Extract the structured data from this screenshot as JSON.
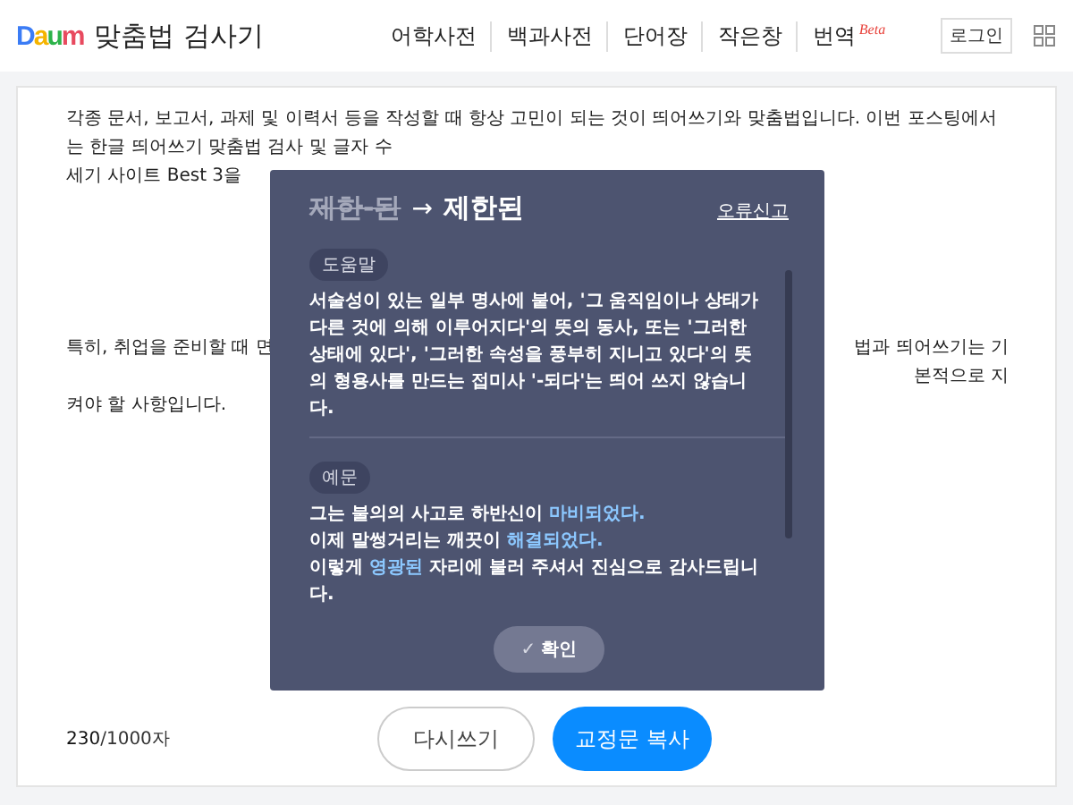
{
  "header": {
    "logo": "Daum",
    "title": "맞춤법 검사기",
    "nav": [
      {
        "label": "어학사전"
      },
      {
        "label": "백과사전"
      },
      {
        "label": "단어장"
      },
      {
        "label": "작은창"
      },
      {
        "label": "번역",
        "badge": "Beta"
      }
    ],
    "login": "로그인"
  },
  "editor": {
    "paragraphs": [
      {
        "lines": [
          {
            "left": "각종 문서, 보고서, 과제 및 이력서 등을 작성할 때 항상 고민이 되는 것이 띄어쓰기와 맞춤법입니다. 이번 포스팅에서는 한글 띄어쓰기 맞춤법 검사 및 글자 수"
          },
          {
            "left": "세기 사이트 Best 3을"
          }
        ]
      },
      {
        "lines": [
          {
            "left": "특히, 취업을 준비할 때 면",
            "right": "법과 띄어쓰기는 기본적으로 지"
          },
          {
            "left": "켜야 할 사항입니다."
          }
        ]
      }
    ],
    "count": "230",
    "limit": "/1000자",
    "buttons": [
      {
        "label": "다시쓰기",
        "kind": "secondary"
      },
      {
        "label": "교정문 복사",
        "kind": "primary"
      }
    ]
  },
  "popup": {
    "wrong": "제한-된",
    "arrow": "→",
    "correct": "제한된",
    "report": "오류신고",
    "sections": [
      {
        "tag": "도움말",
        "lines": [
          [
            {
              "text": "서술성이 있는 일부 명사에 붙어, '그 움직임이나 상태가 다른 것에 의해 이루어지다'의 뜻의 동사, 또는 '그러한 상태에 있다', '그러한 속성을 풍부히 지니고 있다'의 뜻의 형용사를 만드는 접미사 '-되다'는 띄어 쓰지 않습니다.",
              "highlighted": false
            }
          ]
        ]
      },
      {
        "tag": "예문",
        "lines": [
          [
            {
              "text": "그는 불의의 사고로 하반신이 ",
              "highlighted": false
            },
            {
              "text": "마비되었다.",
              "highlighted": true
            }
          ],
          [
            {
              "text": "이제 말썽거리는 깨끗이 ",
              "highlighted": false
            },
            {
              "text": "해결되었다.",
              "highlighted": true
            }
          ],
          [
            {
              "text": "이렇게 ",
              "highlighted": false
            },
            {
              "text": "영광된",
              "highlighted": true
            },
            {
              "text": " 자리에 불러 주셔서 진심으로 감사드립니다.",
              "highlighted": false
            }
          ]
        ]
      }
    ],
    "confirm": {
      "icon": "✓",
      "label": "확인"
    }
  }
}
